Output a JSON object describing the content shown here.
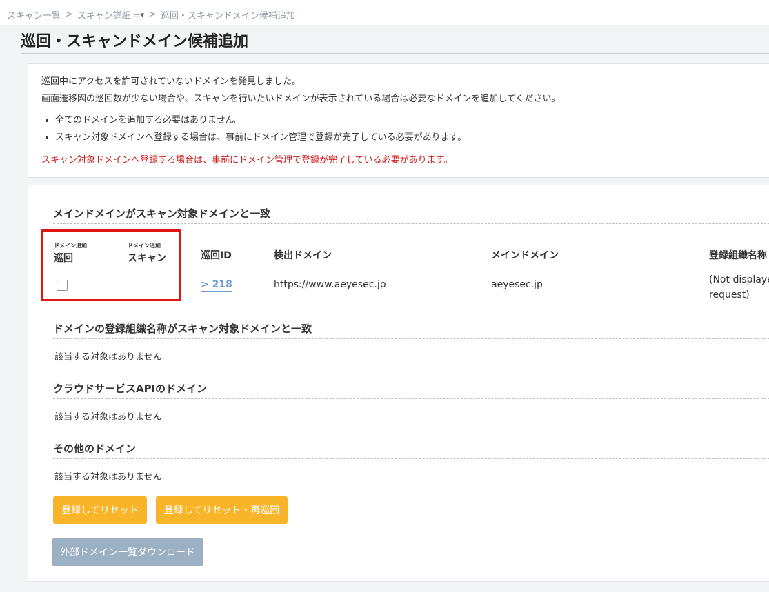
{
  "breadcrumb": {
    "item1": "スキャン一覧",
    "item2": "スキャン詳細",
    "item3": "巡回・スキャンドメイン候補追加"
  },
  "page_title": "巡回・スキャンドメイン候補追加",
  "notice": {
    "line1": "巡回中にアクセスを許可されていないドメインを発見しました。",
    "line2": "画面遷移図の巡回数が少ない場合や、スキャンを行いたいドメインが表示されている場合は必要なドメインを追加してください。",
    "bullets": [
      "全てのドメインを追加する必要はありません。",
      "スキャン対象ドメインへ登録する場合は、事前にドメイン管理で登録が完了している必要があります。"
    ],
    "warning": "スキャン対象ドメインへ登録する場合は、事前にドメイン管理で登録が完了している必要があります。"
  },
  "sections": {
    "main_domain": {
      "title": "メインドメインがスキャン対象ドメインと一致",
      "columns": {
        "patrol_small": "ドメイン追加",
        "patrol": "巡回",
        "scan_small": "ドメイン追加",
        "scan": "スキャン",
        "patrol_id": "巡回ID",
        "detected_domain": "検出ドメイン",
        "main_domain": "メインドメイン",
        "org_name": "登録組織名称"
      },
      "rows": [
        {
          "patrol_id": "218",
          "detected_domain": "https://www.aeyesec.jp",
          "main_domain": "aeyesec.jp",
          "org_name_line1": "(Not displayed",
          "org_name_line2": "request)"
        }
      ]
    },
    "org_name": {
      "title": "ドメインの登録組織名称がスキャン対象ドメインと一致",
      "empty": "該当する対象はありません"
    },
    "cloud_api": {
      "title": "クラウドサービスAPIのドメイン",
      "empty": "該当する対象はありません"
    },
    "other": {
      "title": "その他のドメイン",
      "empty": "該当する対象はありません"
    }
  },
  "buttons": {
    "register_reset": "登録してリセット",
    "register_reset_repatrol": "登録してリセット・再巡回",
    "download": "外部ドメイン一覧ダウンロード"
  },
  "colors": {
    "accent_orange": "#f9b52a",
    "disabled_button": "#9cb0c4",
    "warning_red": "#d11a1a",
    "link_blue": "#6a9bd0",
    "highlight_box": "#e01616"
  }
}
